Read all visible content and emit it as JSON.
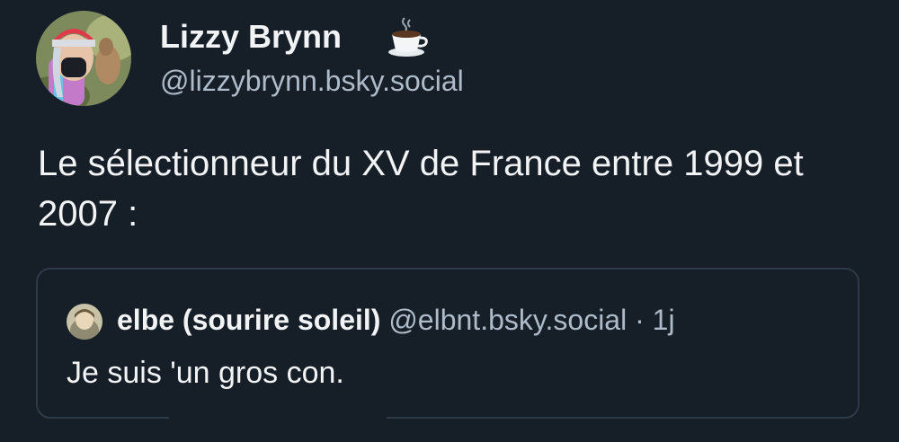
{
  "author": {
    "display_name": "Lizzy Brynn",
    "handle": "@lizzybrynn.bsky.social",
    "badge_icon": "coffee-icon"
  },
  "post": {
    "text": "Le sélectionneur du XV de France entre 1999 et 2007 :"
  },
  "quote": {
    "display_name": "elbe (sourire soleil)",
    "handle": "@elbnt.bsky.social",
    "separator": "·",
    "time": "1j",
    "text": "Je suis 'un gros con."
  },
  "colors": {
    "background": "#161e27",
    "text": "#f1f3f5",
    "muted": "#aebbc9",
    "border": "#2e3a47"
  }
}
